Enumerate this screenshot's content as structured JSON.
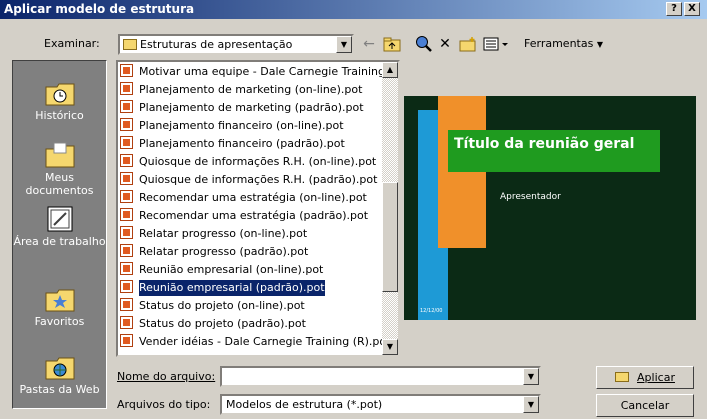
{
  "window": {
    "title": "Aplicar modelo de estrutura",
    "help_btn": "?",
    "close_btn": "X"
  },
  "toolbar": {
    "look_in_label": "Examinar:",
    "look_in_value": "Estruturas de apresentação",
    "tools_label": "Ferramentas"
  },
  "places": [
    {
      "label": "Histórico",
      "icon": "history-icon"
    },
    {
      "label": "Meus documentos",
      "icon": "my-documents-icon"
    },
    {
      "label": "Área de trabalho",
      "icon": "desktop-icon"
    },
    {
      "label": "Favoritos",
      "icon": "favorites-icon"
    },
    {
      "label": "Pastas da Web",
      "icon": "web-folders-icon"
    }
  ],
  "files": [
    "Motivar uma equipe - Dale Carnegie Training ...",
    "Planejamento de marketing (on-line).pot",
    "Planejamento de marketing (padrão).pot",
    "Planejamento financeiro (on-line).pot",
    "Planejamento financeiro (padrão).pot",
    "Quiosque de informações R.H. (on-line).pot",
    "Quiosque de informações R.H. (padrão).pot",
    "Recomendar uma estratégia (on-line).pot",
    "Recomendar uma estratégia (padrão).pot",
    "Relatar progresso (on-line).pot",
    "Relatar progresso (padrão).pot",
    "Reunião empresarial (on-line).pot",
    "Reunião empresarial (padrão).pot",
    "Status do projeto (on-line).pot",
    "Status do projeto (padrão).pot",
    "Vender idéias - Dale Carnegie Training (R).pot"
  ],
  "selected_file_index": 12,
  "preview": {
    "title": "Título da reunião geral",
    "subtitle": "Apresentador",
    "footer": "12/12/00"
  },
  "form": {
    "filename_label": "Nome do arquivo:",
    "filename_value": "",
    "filetype_label": "Arquivos do tipo:",
    "filetype_value": "Modelos de estrutura (*.pot)"
  },
  "buttons": {
    "apply": "Aplicar",
    "cancel": "Cancelar"
  }
}
